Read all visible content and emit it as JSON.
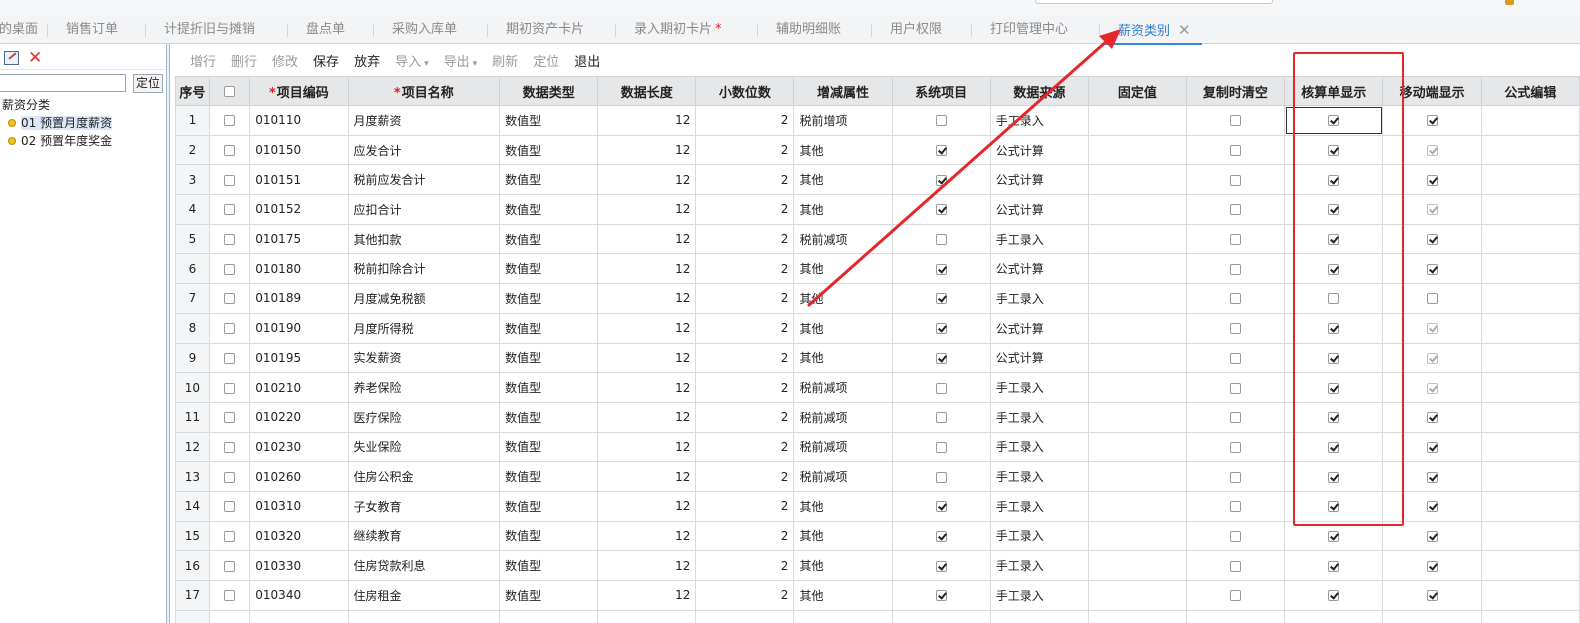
{
  "tabs": [
    {
      "label": "我的桌面",
      "width": 62,
      "active": false,
      "required": false
    },
    {
      "label": "销售订单",
      "width": 98,
      "active": false,
      "required": false
    },
    {
      "label": "计提折旧与摊销",
      "width": 142,
      "active": false,
      "required": false
    },
    {
      "label": "盘点单",
      "width": 86,
      "active": false,
      "required": false
    },
    {
      "label": "采购入库单",
      "width": 114,
      "active": false,
      "required": false
    },
    {
      "label": "期初资产卡片",
      "width": 128,
      "active": false,
      "required": false
    },
    {
      "label": "录入期初卡片",
      "width": 142,
      "active": false,
      "required": true
    },
    {
      "label": "辅助明细账",
      "width": 114,
      "active": false,
      "required": false
    },
    {
      "label": "用户权限",
      "width": 100,
      "active": false,
      "required": false
    },
    {
      "label": "打印管理中心",
      "width": 128,
      "active": false,
      "required": false
    },
    {
      "label": "薪资类别",
      "width": 102,
      "active": true,
      "required": false,
      "closable": true
    }
  ],
  "left_panel": {
    "search_value": "",
    "locate_label": "定位",
    "tree_root": "薪资分类",
    "tree_items": [
      {
        "label": "01 预置月度薪资",
        "selected": true
      },
      {
        "label": "02 预置年度奖金",
        "selected": false
      }
    ]
  },
  "toolbar": [
    {
      "label": "增行",
      "enabled": false,
      "caret": false
    },
    {
      "label": "删行",
      "enabled": false,
      "caret": false
    },
    {
      "label": "修改",
      "enabled": false,
      "caret": false
    },
    {
      "label": "保存",
      "enabled": true,
      "caret": false
    },
    {
      "label": "放弃",
      "enabled": true,
      "caret": false
    },
    {
      "label": "导入",
      "enabled": false,
      "caret": true
    },
    {
      "label": "导出",
      "enabled": false,
      "caret": true
    },
    {
      "label": "刷新",
      "enabled": false,
      "caret": false
    },
    {
      "label": "定位",
      "enabled": false,
      "caret": false
    },
    {
      "label": "退出",
      "enabled": true,
      "caret": false
    }
  ],
  "grid": {
    "columns": [
      {
        "key": "idx",
        "label": "序号",
        "width": 34,
        "kind": "idx"
      },
      {
        "key": "sel",
        "label": "",
        "width": 41,
        "kind": "headcheck"
      },
      {
        "key": "code",
        "label": "项目编码",
        "width": 99,
        "kind": "text",
        "required": true
      },
      {
        "key": "name",
        "label": "项目名称",
        "width": 153,
        "kind": "text",
        "required": true
      },
      {
        "key": "dtype",
        "label": "数据类型",
        "width": 99,
        "kind": "text"
      },
      {
        "key": "dlen",
        "label": "数据长度",
        "width": 99,
        "kind": "num"
      },
      {
        "key": "dec",
        "label": "小数位数",
        "width": 99,
        "kind": "num"
      },
      {
        "key": "attr",
        "label": "增减属性",
        "width": 99,
        "kind": "text"
      },
      {
        "key": "sys",
        "label": "系统项目",
        "width": 99,
        "kind": "check"
      },
      {
        "key": "src",
        "label": "数据来源",
        "width": 99,
        "kind": "text"
      },
      {
        "key": "fixed",
        "label": "固定值",
        "width": 99,
        "kind": "text"
      },
      {
        "key": "clear",
        "label": "复制时清空",
        "width": 99,
        "kind": "check"
      },
      {
        "key": "acct",
        "label": "核算单显示",
        "width": 99,
        "kind": "check"
      },
      {
        "key": "mobile",
        "label": "移动端显示",
        "width": 99,
        "kind": "check"
      },
      {
        "key": "formula",
        "label": "公式编辑",
        "width": 99,
        "kind": "text"
      }
    ],
    "rows": [
      {
        "idx": "1",
        "code": "010110",
        "name": "月度薪资",
        "dtype": "数值型",
        "dlen": "12",
        "dec": "2",
        "attr": "税前增项",
        "sys": false,
        "src": "手工录入",
        "fixed": "",
        "clear": false,
        "acct": true,
        "mobile": true,
        "mobile_disabled": false,
        "formula": ""
      },
      {
        "idx": "2",
        "code": "010150",
        "name": "应发合计",
        "dtype": "数值型",
        "dlen": "12",
        "dec": "2",
        "attr": "其他",
        "sys": true,
        "src": "公式计算",
        "fixed": "",
        "clear": false,
        "acct": true,
        "mobile": true,
        "mobile_disabled": true,
        "formula": ""
      },
      {
        "idx": "3",
        "code": "010151",
        "name": "税前应发合计",
        "dtype": "数值型",
        "dlen": "12",
        "dec": "2",
        "attr": "其他",
        "sys": true,
        "src": "公式计算",
        "fixed": "",
        "clear": false,
        "acct": true,
        "mobile": true,
        "mobile_disabled": false,
        "formula": ""
      },
      {
        "idx": "4",
        "code": "010152",
        "name": "应扣合计",
        "dtype": "数值型",
        "dlen": "12",
        "dec": "2",
        "attr": "其他",
        "sys": true,
        "src": "公式计算",
        "fixed": "",
        "clear": false,
        "acct": true,
        "mobile": true,
        "mobile_disabled": true,
        "formula": ""
      },
      {
        "idx": "5",
        "code": "010175",
        "name": "其他扣款",
        "dtype": "数值型",
        "dlen": "12",
        "dec": "2",
        "attr": "税前减项",
        "sys": false,
        "src": "手工录入",
        "fixed": "",
        "clear": false,
        "acct": true,
        "mobile": true,
        "mobile_disabled": false,
        "formula": ""
      },
      {
        "idx": "6",
        "code": "010180",
        "name": "税前扣除合计",
        "dtype": "数值型",
        "dlen": "12",
        "dec": "2",
        "attr": "其他",
        "sys": true,
        "src": "公式计算",
        "fixed": "",
        "clear": false,
        "acct": true,
        "mobile": true,
        "mobile_disabled": false,
        "formula": ""
      },
      {
        "idx": "7",
        "code": "010189",
        "name": "月度减免税额",
        "dtype": "数值型",
        "dlen": "12",
        "dec": "2",
        "attr": "其他",
        "sys": true,
        "src": "手工录入",
        "fixed": "",
        "clear": false,
        "acct": false,
        "mobile": false,
        "mobile_disabled": false,
        "formula": ""
      },
      {
        "idx": "8",
        "code": "010190",
        "name": "月度所得税",
        "dtype": "数值型",
        "dlen": "12",
        "dec": "2",
        "attr": "其他",
        "sys": true,
        "src": "公式计算",
        "fixed": "",
        "clear": false,
        "acct": true,
        "mobile": true,
        "mobile_disabled": true,
        "formula": ""
      },
      {
        "idx": "9",
        "code": "010195",
        "name": "实发薪资",
        "dtype": "数值型",
        "dlen": "12",
        "dec": "2",
        "attr": "其他",
        "sys": true,
        "src": "公式计算",
        "fixed": "",
        "clear": false,
        "acct": true,
        "mobile": true,
        "mobile_disabled": true,
        "formula": ""
      },
      {
        "idx": "10",
        "code": "010210",
        "name": "养老保险",
        "dtype": "数值型",
        "dlen": "12",
        "dec": "2",
        "attr": "税前减项",
        "sys": false,
        "src": "手工录入",
        "fixed": "",
        "clear": false,
        "acct": true,
        "mobile": true,
        "mobile_disabled": true,
        "formula": ""
      },
      {
        "idx": "11",
        "code": "010220",
        "name": "医疗保险",
        "dtype": "数值型",
        "dlen": "12",
        "dec": "2",
        "attr": "税前减项",
        "sys": false,
        "src": "手工录入",
        "fixed": "",
        "clear": false,
        "acct": true,
        "mobile": true,
        "mobile_disabled": false,
        "formula": ""
      },
      {
        "idx": "12",
        "code": "010230",
        "name": "失业保险",
        "dtype": "数值型",
        "dlen": "12",
        "dec": "2",
        "attr": "税前减项",
        "sys": false,
        "src": "手工录入",
        "fixed": "",
        "clear": false,
        "acct": true,
        "mobile": true,
        "mobile_disabled": false,
        "formula": ""
      },
      {
        "idx": "13",
        "code": "010260",
        "name": "住房公积金",
        "dtype": "数值型",
        "dlen": "12",
        "dec": "2",
        "attr": "税前减项",
        "sys": false,
        "src": "手工录入",
        "fixed": "",
        "clear": false,
        "acct": true,
        "mobile": true,
        "mobile_disabled": false,
        "formula": ""
      },
      {
        "idx": "14",
        "code": "010310",
        "name": "子女教育",
        "dtype": "数值型",
        "dlen": "12",
        "dec": "2",
        "attr": "其他",
        "sys": true,
        "src": "手工录入",
        "fixed": "",
        "clear": false,
        "acct": true,
        "mobile": true,
        "mobile_disabled": false,
        "formula": ""
      },
      {
        "idx": "15",
        "code": "010320",
        "name": "继续教育",
        "dtype": "数值型",
        "dlen": "12",
        "dec": "2",
        "attr": "其他",
        "sys": true,
        "src": "手工录入",
        "fixed": "",
        "clear": false,
        "acct": true,
        "mobile": true,
        "mobile_disabled": false,
        "formula": ""
      },
      {
        "idx": "16",
        "code": "010330",
        "name": "住房贷款利息",
        "dtype": "数值型",
        "dlen": "12",
        "dec": "2",
        "attr": "其他",
        "sys": true,
        "src": "手工录入",
        "fixed": "",
        "clear": false,
        "acct": true,
        "mobile": true,
        "mobile_disabled": false,
        "formula": ""
      },
      {
        "idx": "17",
        "code": "010340",
        "name": "住房租金",
        "dtype": "数值型",
        "dlen": "12",
        "dec": "2",
        "attr": "其他",
        "sys": true,
        "src": "手工录入",
        "fixed": "",
        "clear": false,
        "acct": true,
        "mobile": true,
        "mobile_disabled": false,
        "formula": ""
      },
      {
        "idx": "",
        "code": "",
        "name": "",
        "dtype": "",
        "dlen": "",
        "dec": "",
        "attr": "",
        "sys": false,
        "src": "",
        "fixed": "",
        "clear": false,
        "acct": false,
        "mobile": false,
        "mobile_disabled": false,
        "formula": "",
        "partial": true
      }
    ]
  },
  "icons": {
    "edit": "edit-icon",
    "delete": "delete-icon",
    "close_tab": "close-icon",
    "tree_node": "tree-node-icon",
    "caret": "caret-down-icon"
  },
  "colors": {
    "accent": "#2f80d0",
    "annotation": "#e5262a",
    "required": "#e02020"
  }
}
